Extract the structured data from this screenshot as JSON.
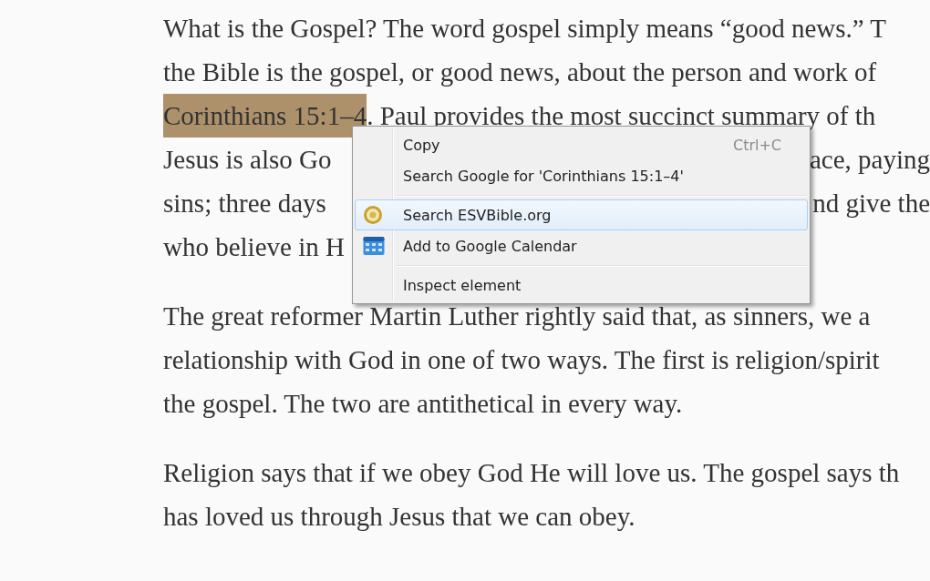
{
  "article": {
    "paragraphs": [
      {
        "lines": [
          {
            "segments": [
              {
                "text": "What is the Gospel? The word gospel simply means “good news.” T",
                "highlighted": false
              }
            ]
          },
          {
            "segments": [
              {
                "text": "the Bible is the gospel, or good news, about the person and work of",
                "highlighted": false
              }
            ]
          },
          {
            "segments": [
              {
                "text": "Corinthians 15:1–4",
                "highlighted": true
              },
              {
                "text": ". Paul provides the most succinct summary of th",
                "highlighted": false
              }
            ]
          },
          {
            "segments": [
              {
                "text": "Jesus is also Go",
                "highlighted": false
              }
            ],
            "end": "ace, paying"
          },
          {
            "segments": [
              {
                "text": "sins; three days",
                "highlighted": false
              }
            ],
            "end": "nd give the"
          },
          {
            "segments": [
              {
                "text": "who believe in H",
                "highlighted": false
              }
            ]
          }
        ]
      },
      {
        "lines": [
          {
            "segments": [
              {
                "text": "The great reformer Martin Luther rightly said that, as sinners, we a",
                "highlighted": false
              }
            ]
          },
          {
            "segments": [
              {
                "text": "relationship with God in one of two ways. The first is religion/spirit",
                "highlighted": false
              }
            ]
          },
          {
            "segments": [
              {
                "text": "the gospel. The two are antithetical in every way.",
                "highlighted": false
              }
            ]
          }
        ]
      },
      {
        "lines": [
          {
            "segments": [
              {
                "text": "Religion says that if we obey God He will love us. The gospel says th",
                "highlighted": false
              }
            ]
          },
          {
            "segments": [
              {
                "text": "has loved us through Jesus that we can obey.",
                "highlighted": false
              }
            ]
          }
        ]
      }
    ]
  },
  "context_menu": {
    "items": [
      {
        "kind": "text",
        "label": "Copy",
        "shortcut": "Ctrl+C",
        "selected": false
      },
      {
        "kind": "text",
        "label": "Search Google for 'Corinthians 15:1–4'",
        "selected": false
      },
      {
        "kind": "separator"
      },
      {
        "kind": "bible",
        "label": "Search ESVBible.org",
        "selected": true
      },
      {
        "kind": "calendar",
        "label": "Add to Google Calendar",
        "selected": false
      },
      {
        "kind": "separator"
      },
      {
        "kind": "text",
        "label": "Inspect element",
        "selected": false
      }
    ]
  }
}
